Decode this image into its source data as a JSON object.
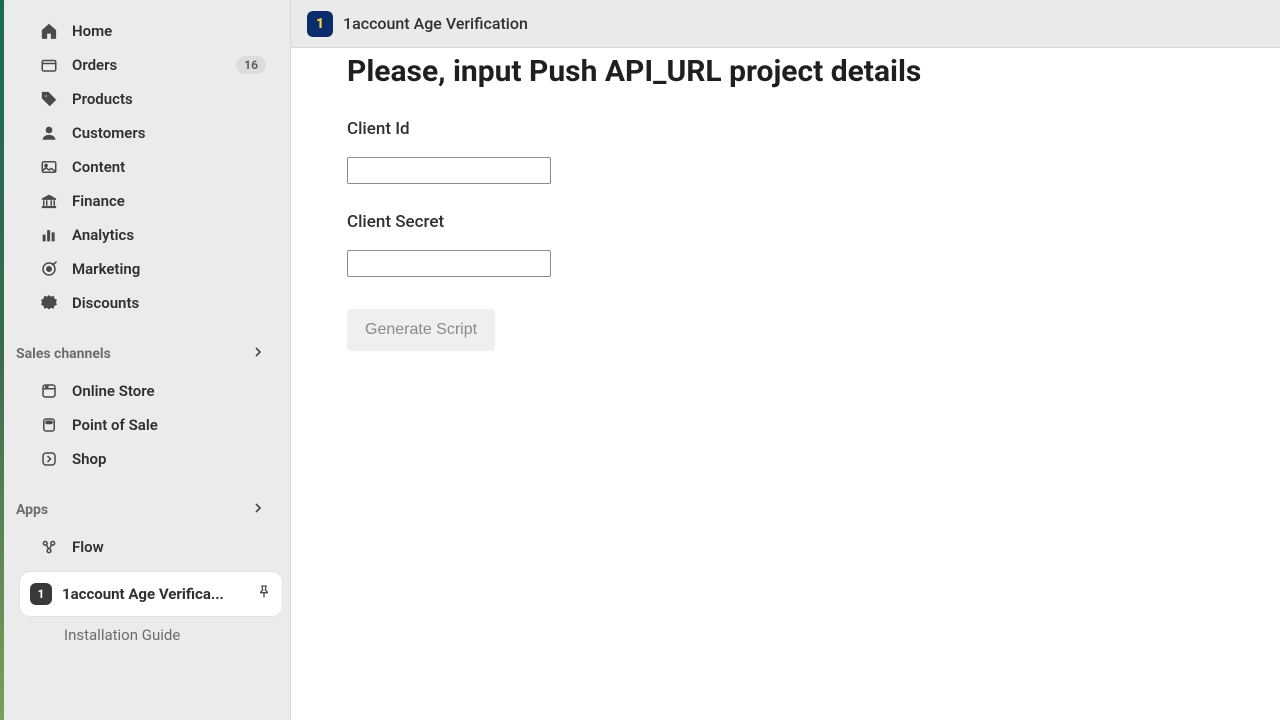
{
  "sidebar": {
    "nav": [
      {
        "label": "Home"
      },
      {
        "label": "Orders",
        "badge": "16"
      },
      {
        "label": "Products"
      },
      {
        "label": "Customers"
      },
      {
        "label": "Content"
      },
      {
        "label": "Finance"
      },
      {
        "label": "Analytics"
      },
      {
        "label": "Marketing"
      },
      {
        "label": "Discounts"
      }
    ],
    "sections": {
      "sales_channels": {
        "title": "Sales channels"
      },
      "apps": {
        "title": "Apps"
      }
    },
    "channels": [
      {
        "label": "Online Store"
      },
      {
        "label": "Point of Sale"
      },
      {
        "label": "Shop"
      }
    ],
    "apps_list": [
      {
        "label": "Flow"
      }
    ],
    "selected_app": {
      "icon_text": "1",
      "label": "1account Age Verifica...",
      "sub_item": "Installation Guide"
    }
  },
  "header": {
    "app_logo_text": "1",
    "title": "1account Age Verification"
  },
  "main": {
    "heading": "Please, input Push API_URL project details",
    "client_id_label": "Client Id",
    "client_id_value": "",
    "client_secret_label": "Client Secret",
    "client_secret_value": "",
    "generate_button": "Generate Script"
  }
}
